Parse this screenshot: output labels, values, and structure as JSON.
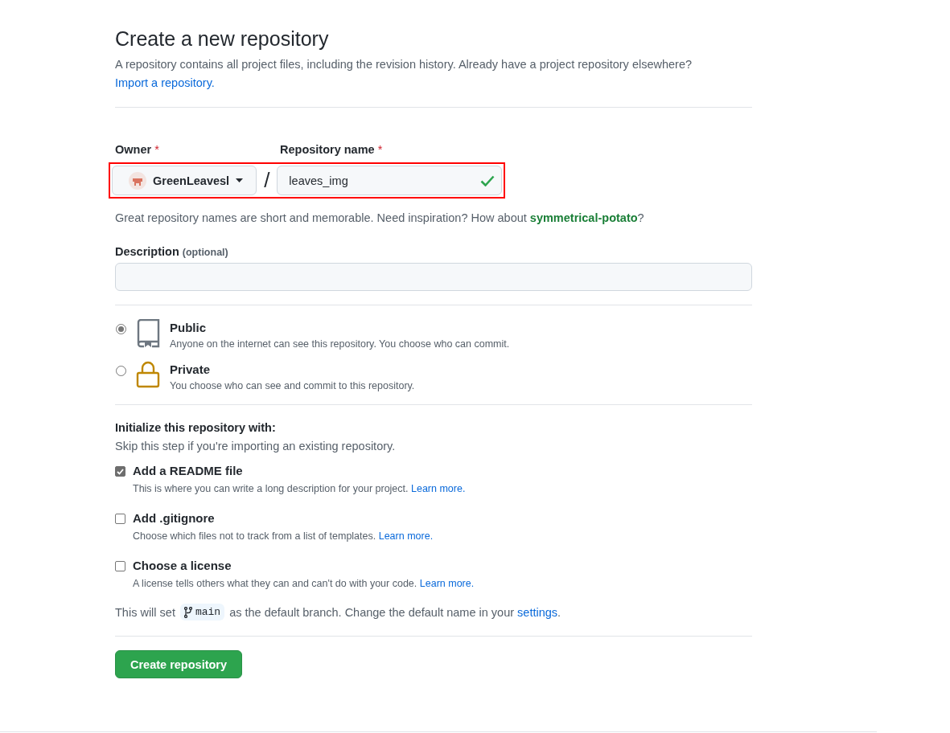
{
  "title": "Create a new repository",
  "intro": {
    "text": "A repository contains all project files, including the revision history. Already have a project repository elsewhere?",
    "link": "Import a repository."
  },
  "owner": {
    "label": "Owner",
    "required_mark": "*",
    "value": "GreenLeavesl"
  },
  "separator": "/",
  "repo_name": {
    "label": "Repository name",
    "required_mark": "*",
    "value": "leaves_img",
    "valid": true
  },
  "name_hint": {
    "text_before": "Great repository names are short and memorable. Need inspiration? How about",
    "suggestion": "symmetrical-potato",
    "text_after": "?"
  },
  "description": {
    "label": "Description",
    "optional": "(optional)"
  },
  "visibility": [
    {
      "kind": "public",
      "label": "Public",
      "description": "Anyone on the internet can see this repository. You choose who can commit.",
      "selected": true
    },
    {
      "kind": "private",
      "label": "Private",
      "description": "You choose who can see and commit to this repository.",
      "selected": false
    }
  ],
  "initialize": {
    "heading": "Initialize this repository with:",
    "subheading": "Skip this step if you're importing an existing repository.",
    "options": [
      {
        "label": "Add a README file",
        "description": "This is where you can write a long description for your project.",
        "link": "Learn more.",
        "checked": true
      },
      {
        "label": "Add .gitignore",
        "description": "Choose which files not to track from a list of templates.",
        "link": "Learn more.",
        "checked": false
      },
      {
        "label": "Choose a license",
        "description": "A license tells others what they can and can't do with your code.",
        "link": "Learn more.",
        "checked": false
      }
    ]
  },
  "branch_note": {
    "text_before": "This will set",
    "branch": "main",
    "text_middle": "as the default branch. Change the default name in your",
    "link": "settings",
    "text_after": "."
  },
  "submit": "Create repository"
}
